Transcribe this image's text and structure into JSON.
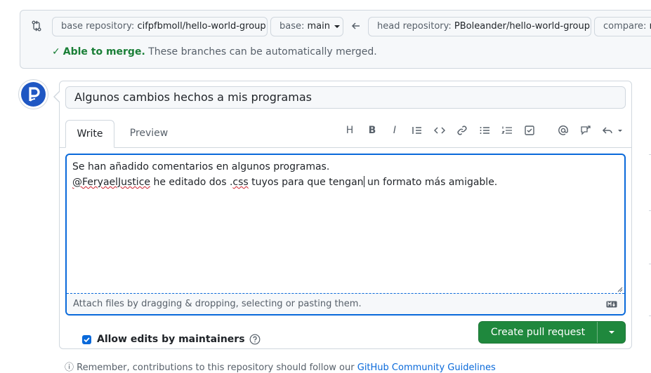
{
  "compare": {
    "base_repo_prefix": "base repository:",
    "base_repo": "cifpfbmoll/hello-world-group",
    "base_prefix": "base:",
    "base": "main",
    "head_repo_prefix": "head repository:",
    "head_repo": "PBoleander/hello-world-group",
    "compare_prefix": "compare:",
    "compare_value": "m",
    "merge_ok": "Able to merge.",
    "merge_msg": "These branches can be automatically merged."
  },
  "form": {
    "title_value": "Algunos cambios hechos a mis programas",
    "tabs": [
      {
        "label": "Write"
      },
      {
        "label": "Preview"
      }
    ],
    "toolbar": {
      "heading": "H",
      "bold": "B",
      "italic": "I"
    },
    "body_line1": "Se han añadido comentarios en algunos programas.",
    "body_line2_mention": "@FeryaelJustice",
    "body_line2_a": " he editado dos .",
    "body_line2_css": "css",
    "body_line2_b": " tuyos para que tengan",
    "body_line2_c": " un formato más amigable.",
    "attach_text": "Attach files by dragging & dropping, selecting or pasting them.",
    "allow_edits_label": "Allow edits by maintainers",
    "create_button": "Create pull request"
  },
  "footer": {
    "text": "Remember, contributions to this repository should follow our",
    "link": "GitHub Community Guidelines"
  },
  "colors": {
    "accent": "#0969da",
    "success": "#1a7f37",
    "button": "#1f883d",
    "border": "#d0d7de"
  }
}
